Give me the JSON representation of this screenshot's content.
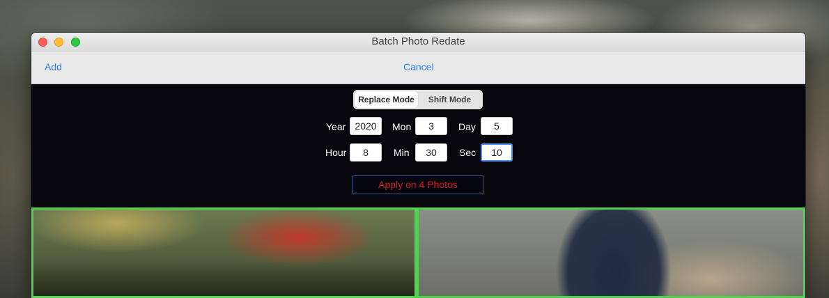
{
  "window": {
    "title": "Batch Photo Redate"
  },
  "navbar": {
    "add_label": "Add",
    "cancel_label": "Cancel"
  },
  "mode": {
    "options": [
      "Replace Mode",
      "Shift Mode"
    ],
    "selected": "Replace Mode"
  },
  "fields": {
    "year": {
      "label": "Year",
      "value": "2020"
    },
    "month": {
      "label": "Mon",
      "value": "3"
    },
    "day": {
      "label": "Day",
      "value": "5"
    },
    "hour": {
      "label": "Hour",
      "value": "8"
    },
    "min": {
      "label": "Min",
      "value": "30"
    },
    "sec": {
      "label": "Sec",
      "value": "10"
    }
  },
  "apply_label": "Apply on 4 Photos",
  "colors": {
    "accent": "#2f7ff0",
    "apply_text": "#d81a1a",
    "selection_border": "#4fd44f"
  }
}
